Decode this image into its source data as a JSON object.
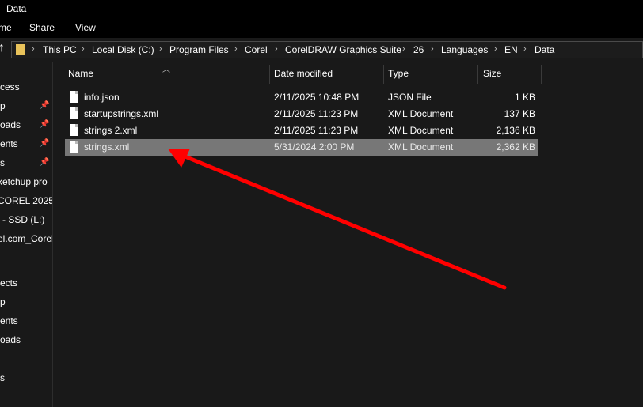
{
  "window": {
    "title": "Data"
  },
  "ribbon": {
    "tabs": [
      "me",
      "Share",
      "View"
    ]
  },
  "address": {
    "crumbs": [
      "This PC",
      "Local Disk (C:)",
      "Program Files",
      "Corel",
      "CorelDRAW Graphics Suite",
      "26",
      "Languages",
      "EN",
      "Data"
    ]
  },
  "nav": {
    "items": [
      "cess",
      "p",
      "oads",
      "ents",
      "s",
      "ketchup pro",
      "COREL 2025 V",
      "l - SSD (L:)",
      "el.com_Corel",
      "ects",
      "p",
      "ents",
      "oads",
      "s"
    ]
  },
  "columns": {
    "name": "Name",
    "date": "Date modified",
    "type": "Type",
    "size": "Size"
  },
  "files": [
    {
      "name": "info.json",
      "date": "2/11/2025 10:48 PM",
      "type": "JSON File",
      "size": "1 KB"
    },
    {
      "name": "startupstrings.xml",
      "date": "2/11/2025 11:23 PM",
      "type": "XML Document",
      "size": "137 KB"
    },
    {
      "name": "strings 2.xml",
      "date": "2/11/2025 11:23 PM",
      "type": "XML Document",
      "size": "2,136 KB"
    },
    {
      "name": "strings.xml",
      "date": "5/31/2024 2:00 PM",
      "type": "XML Document",
      "size": "2,362 KB"
    }
  ],
  "annotation": {
    "color": "#ff0000"
  }
}
